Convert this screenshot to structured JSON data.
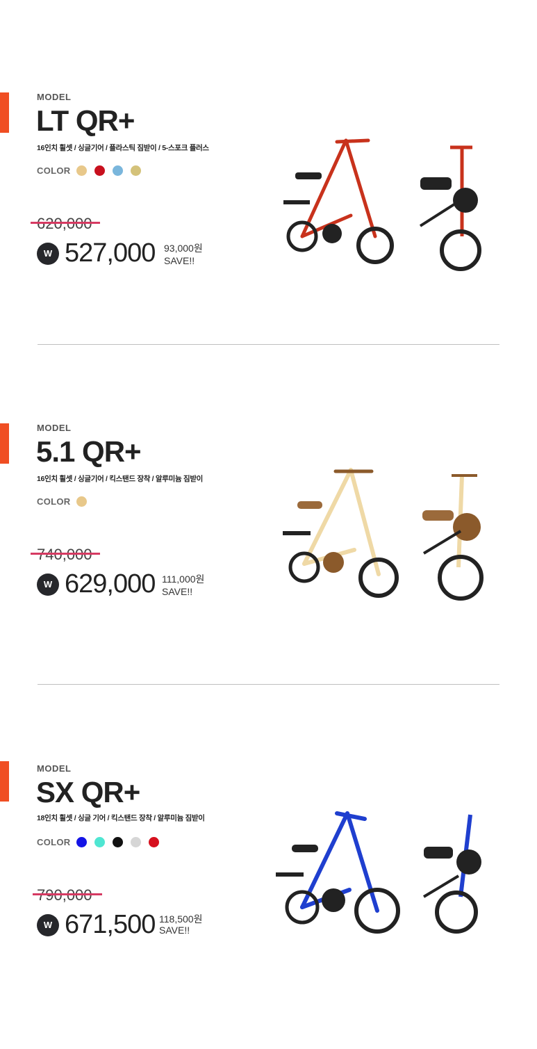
{
  "products": [
    {
      "model_label": "MODEL",
      "name": "LT QR+",
      "spec": "16인치 휠셋 / 싱글기어 / 플라스틱 짐받이 / 5-스포크 플러스",
      "color_label": "COLOR",
      "colors": [
        "#e8c88a",
        "#c8101e",
        "#7ab6dc",
        "#d4c27a"
      ],
      "original_price": "620,000",
      "currency_badge": "W",
      "sale_price": "527,000",
      "save_amount": "93,000원",
      "save_text": "SAVE!!",
      "bike_color": "#c8321c",
      "bike_image": "red-strida-bike-image"
    },
    {
      "model_label": "MODEL",
      "name": "5.1 QR+",
      "spec": "16인치 휠셋 / 싱글기어 / 킥스탠드 장착 / 알루미늄 짐받이",
      "color_label": "COLOR",
      "colors": [
        "#e8c88a"
      ],
      "original_price": "740,000",
      "currency_badge": "W",
      "sale_price": "629,000",
      "save_amount": "111,000원",
      "save_text": "SAVE!!",
      "bike_color": "#efd9a6",
      "bike_image": "cream-strida-bike-image"
    },
    {
      "model_label": "MODEL",
      "name": "SX QR+",
      "spec": "18인치 휠셋 / 싱글 기어 / 킥스탠드 장착 / 알루미늄 짐받이",
      "color_label": "COLOR",
      "colors": [
        "#1414e6",
        "#4fe6d2",
        "#111111",
        "#d6d6d6",
        "#d6101e"
      ],
      "original_price": "790,000",
      "currency_badge": "W",
      "sale_price": "671,500",
      "save_amount": "118,500원",
      "save_text": "SAVE!!",
      "bike_color": "#1f3fcf",
      "bike_image": "blue-strida-bike-image"
    }
  ]
}
